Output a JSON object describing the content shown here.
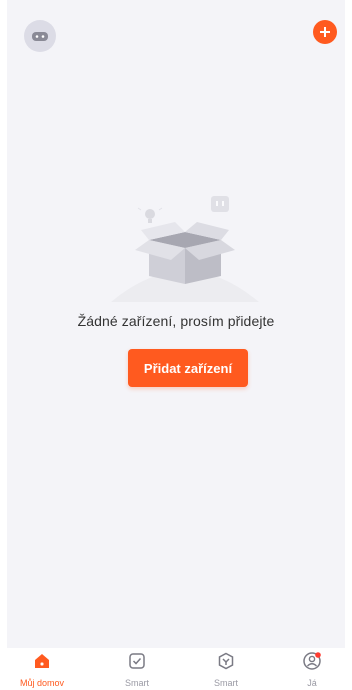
{
  "colors": {
    "accent": "#ff5a1f",
    "background": "#f4f4f8",
    "tab_inactive": "#9a9aa4"
  },
  "header": {
    "avatar_icon": "robot-avatar-icon",
    "add_icon": "plus-circle-icon"
  },
  "empty_state": {
    "illustration": "empty-box-illustration",
    "message": "Žádné zařízení, prosím přidejte",
    "button_label": "Přidat zařízení"
  },
  "tabbar": {
    "items": [
      {
        "label": "Můj domov",
        "icon": "home-icon",
        "active": true
      },
      {
        "label": "Smart",
        "icon": "checkbox-icon",
        "active": false
      },
      {
        "label": "Smart",
        "icon": "hexagon-check-icon",
        "active": false
      },
      {
        "label": "Já",
        "icon": "profile-icon",
        "active": false
      }
    ]
  }
}
